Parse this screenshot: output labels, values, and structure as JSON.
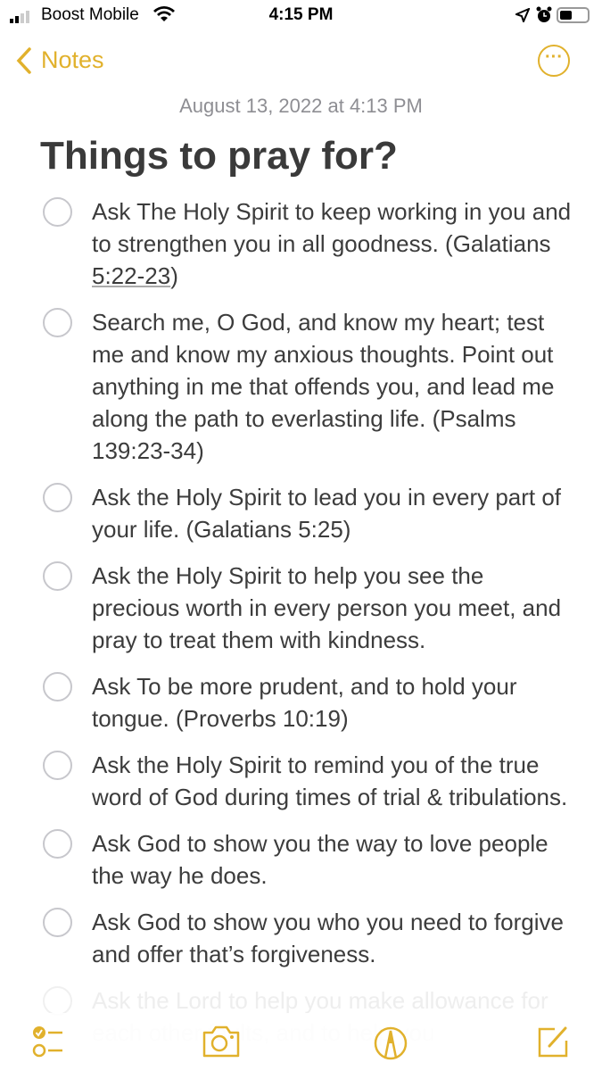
{
  "status": {
    "carrier": "Boost Mobile",
    "time": "4:15 PM",
    "battery_level": 0.45
  },
  "nav": {
    "back_label": "Notes",
    "more_icon": "ellipsis-circle-icon"
  },
  "note": {
    "date": "August 13, 2022 at 4:13 PM",
    "title": "Things to pray for?",
    "items": [
      {
        "text": "Ask The Holy Spirit to keep working in you and to strengthen you in all goodness. (Galatians ",
        "ref": "5:22-23",
        "after": ")",
        "checked": false
      },
      {
        "text": "Search me, O God, and know my heart; test me and know my anxious thoughts. Point out anything in me that offends you, and lead me along the path to everlasting life. (Psalms 139:23-34)",
        "checked": false
      },
      {
        "text": "Ask the Holy Spirit to lead you in every part of your life. (Galatians 5:25)",
        "checked": false
      },
      {
        "text": "Ask the Holy Spirit to help you see the precious worth in every person you meet, and pray to treat them with kindness.",
        "checked": false
      },
      {
        "text": "Ask To be more prudent, and to hold your tongue. (Proverbs 10:19)",
        "checked": false
      },
      {
        "text": "Ask the Holy Spirit to remind you of the true word of God during times of trial & tribulations.",
        "checked": false
      },
      {
        "text": "Ask God to show you the way to love people the way he does.",
        "checked": false
      },
      {
        "text": "Ask God to show you who you need to forgive and offer that’s forgiveness.",
        "checked": false
      },
      {
        "text": "Ask the Lord to help you make allowance for each other faults, and to help you",
        "checked": false
      }
    ]
  },
  "toolbar": {
    "icons": [
      "checklist-icon",
      "camera-icon",
      "markup-icon",
      "compose-icon"
    ]
  },
  "colors": {
    "accent": "#e1b12c"
  }
}
